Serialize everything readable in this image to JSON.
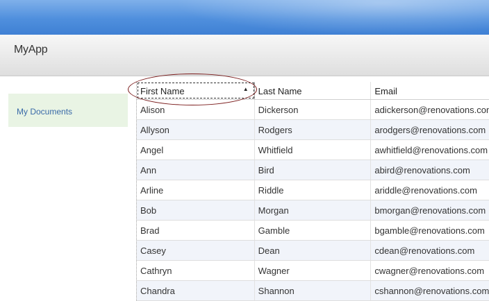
{
  "app": {
    "title": "MyApp"
  },
  "sidebar": {
    "items": [
      {
        "label": "My Documents"
      }
    ]
  },
  "grid": {
    "columns": [
      "First Name",
      "Last Name",
      "Email"
    ],
    "sort": {
      "column": "First Name",
      "direction": "ascending",
      "icon": "sort-ascending-icon"
    },
    "rows": [
      [
        "Alison",
        "Dickerson",
        "adickerson@renovations.com"
      ],
      [
        "Allyson",
        "Rodgers",
        "arodgers@renovations.com"
      ],
      [
        "Angel",
        "Whitfield",
        "awhitfield@renovations.com"
      ],
      [
        "Ann",
        "Bird",
        "abird@renovations.com"
      ],
      [
        "Arline",
        "Riddle",
        "ariddle@renovations.com"
      ],
      [
        "Bob",
        "Morgan",
        "bmorgan@renovations.com"
      ],
      [
        "Brad",
        "Gamble",
        "bgamble@renovations.com"
      ],
      [
        "Casey",
        "Dean",
        "cdean@renovations.com"
      ],
      [
        "Cathryn",
        "Wagner",
        "cwagner@renovations.com"
      ],
      [
        "Chandra",
        "Shannon",
        "cshannon@renovations.com"
      ]
    ]
  },
  "colors": {
    "banner": "#4f8fdd",
    "sidebar_selected": "#e9f4e4",
    "link": "#3a6aa8",
    "annotation": "#7a1a1a"
  }
}
